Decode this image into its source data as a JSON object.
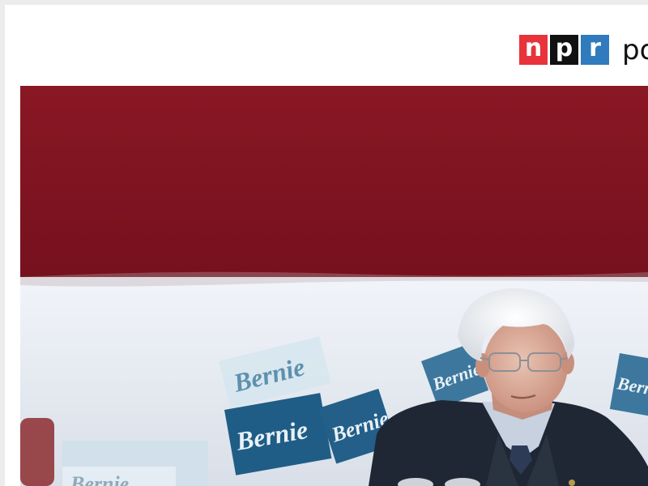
{
  "header": {
    "logo": {
      "letters": [
        "n",
        "p",
        "r"
      ],
      "colors": [
        "#e8333a",
        "#111111",
        "#2f7bbd"
      ]
    },
    "section_label": "po"
  },
  "hero": {
    "signs": [
      "Bernie",
      "Bernie",
      "Bernie",
      "Bernie",
      "Bernie",
      "Bernie"
    ],
    "colors": {
      "backdrop_red": "#7e1320",
      "backdrop_white": "#e9edf4",
      "sign_blue": "#1f5d86",
      "suit": "#1f2734"
    }
  }
}
